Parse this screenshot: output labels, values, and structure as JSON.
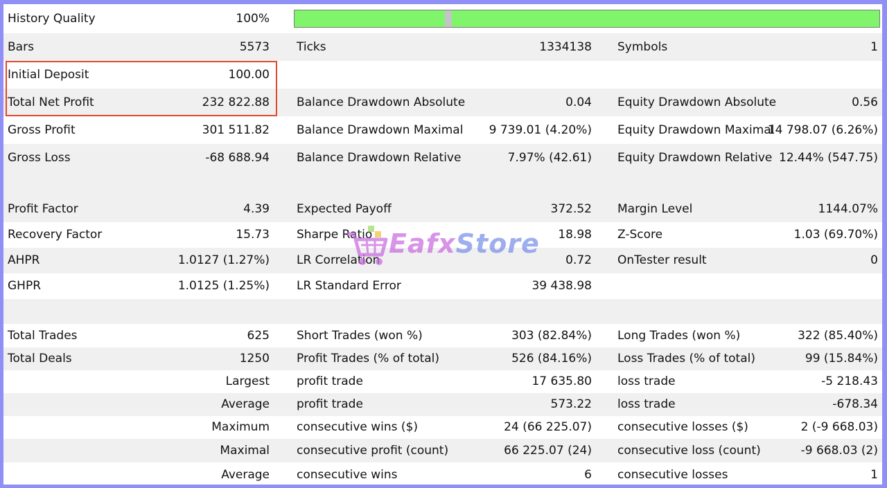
{
  "history_quality": {
    "label": "History Quality",
    "value": "100%",
    "bar_fraction": 1.0
  },
  "stats": [
    {
      "c1": [
        "Bars",
        "5573"
      ],
      "c2": [
        "Ticks",
        "1334138"
      ],
      "c3": [
        "Symbols",
        "1"
      ]
    },
    {
      "c1": [
        "Initial Deposit",
        "100.00"
      ],
      "c2": [
        "",
        ""
      ],
      "c3": [
        "",
        ""
      ]
    },
    {
      "c1": [
        "Total Net Profit",
        "232 822.88"
      ],
      "c2": [
        "Balance Drawdown Absolute",
        "0.04"
      ],
      "c3": [
        "Equity Drawdown Absolute",
        "0.56"
      ]
    },
    {
      "c1": [
        "Gross Profit",
        "301 511.82"
      ],
      "c2": [
        "Balance Drawdown Maximal",
        "9 739.01 (4.20%)"
      ],
      "c3": [
        "Equity Drawdown Maximal",
        "14 798.07 (6.26%)"
      ]
    },
    {
      "c1": [
        "Gross Loss",
        "-68 688.94"
      ],
      "c2": [
        "Balance Drawdown Relative",
        "7.97% (42.61)"
      ],
      "c3": [
        "Equity Drawdown Relative",
        "12.44% (547.75)"
      ]
    },
    {
      "c1": [
        "Profit Factor",
        "4.39"
      ],
      "c2": [
        "Expected Payoff",
        "372.52"
      ],
      "c3": [
        "Margin Level",
        "1144.07%"
      ]
    },
    {
      "c1": [
        "Recovery Factor",
        "15.73"
      ],
      "c2": [
        "Sharpe Ratio",
        "18.98"
      ],
      "c3": [
        "Z-Score",
        "1.03 (69.70%)"
      ]
    },
    {
      "c1": [
        "AHPR",
        "1.0127 (1.27%)"
      ],
      "c2": [
        "LR Correlation",
        "0.72"
      ],
      "c3": [
        "OnTester result",
        "0"
      ]
    },
    {
      "c1": [
        "GHPR",
        "1.0125 (1.25%)"
      ],
      "c2": [
        "LR Standard Error",
        "39 438.98"
      ],
      "c3": [
        "",
        ""
      ]
    },
    {
      "c1": [
        "Total Trades",
        "625"
      ],
      "c2": [
        "Short Trades (won %)",
        "303 (82.84%)"
      ],
      "c3": [
        "Long Trades (won %)",
        "322 (85.40%)"
      ]
    },
    {
      "c1": [
        "Total Deals",
        "1250"
      ],
      "c2": [
        "Profit Trades (% of total)",
        "526 (84.16%)"
      ],
      "c3": [
        "Loss Trades (% of total)",
        "99 (15.84%)"
      ]
    },
    {
      "c1": [
        "",
        "Largest"
      ],
      "c2": [
        "profit trade",
        "17 635.80"
      ],
      "c3": [
        "loss trade",
        "-5 218.43"
      ]
    },
    {
      "c1": [
        "",
        "Average"
      ],
      "c2": [
        "profit trade",
        "573.22"
      ],
      "c3": [
        "loss trade",
        "-678.34"
      ]
    },
    {
      "c1": [
        "",
        "Maximum"
      ],
      "c2": [
        "consecutive wins ($)",
        "24 (66 225.07)"
      ],
      "c3": [
        "consecutive losses ($)",
        "2 (-9 668.03)"
      ]
    },
    {
      "c1": [
        "",
        "Maximal"
      ],
      "c2": [
        "consecutive profit (count)",
        "66 225.07 (24)"
      ],
      "c3": [
        "consecutive loss (count)",
        "-9 668.03 (2)"
      ]
    },
    {
      "c1": [
        "",
        "Average"
      ],
      "c2": [
        "consecutive wins",
        "6"
      ],
      "c3": [
        "consecutive losses",
        "1"
      ]
    }
  ],
  "watermark": {
    "part1": "Eafx",
    "part2": "Store",
    "icon": "shopping-cart-icon"
  },
  "colors": {
    "quality_bar": "#80f56c",
    "highlight_border": "#e0492b",
    "frame": "#8f8ff5"
  }
}
